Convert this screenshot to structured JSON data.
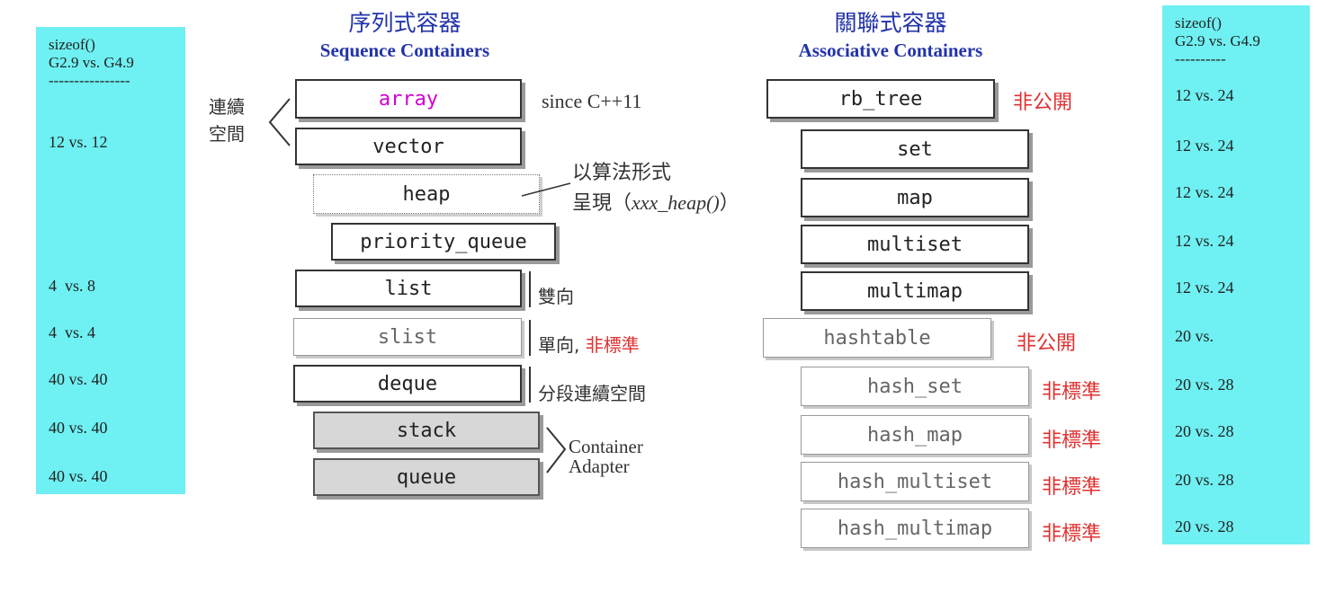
{
  "left_panel": {
    "header": "sizeof()\nG2.9 vs. G4.9\n----------------",
    "values": [
      "12 vs. 12",
      "4  vs. 8",
      "4  vs. 4",
      "40 vs. 40",
      "40 vs. 40",
      "40 vs. 40"
    ]
  },
  "right_panel": {
    "header": "sizeof()\nG2.9 vs. G4.9\n----------",
    "values": [
      "12 vs. 24",
      "12 vs. 24",
      "12 vs. 24",
      "12 vs. 24",
      "12 vs. 24",
      "20 vs.",
      "20 vs. 28",
      "20 vs. 28",
      "20 vs. 28",
      "20 vs. 28"
    ]
  },
  "sequence": {
    "title_cn": "序列式容器",
    "title_en": "Sequence Containers",
    "boxes": [
      "array",
      "vector",
      "heap",
      "priority_queue",
      "list",
      "slist",
      "deque",
      "stack",
      "queue"
    ],
    "notes": {
      "contiguous": "連續\n空間",
      "since": "since C++11",
      "heap_cn": "以算法形式",
      "heap_cn2": "呈現（",
      "heap_fn": "xxx_heap()",
      "heap_close": "）",
      "list": "雙向",
      "slist_a": "單向,",
      "slist_b": "非標準",
      "deque": "分段連續空間",
      "adapter": "Container\nAdapter"
    }
  },
  "associative": {
    "title_cn": "關聯式容器",
    "title_en": "Associative Containers",
    "boxes": [
      "rb_tree",
      "set",
      "map",
      "multiset",
      "multimap",
      "hashtable",
      "hash_set",
      "hash_map",
      "hash_multiset",
      "hash_multimap"
    ],
    "notes": {
      "private": "非公開",
      "nonstandard": "非標準"
    }
  }
}
